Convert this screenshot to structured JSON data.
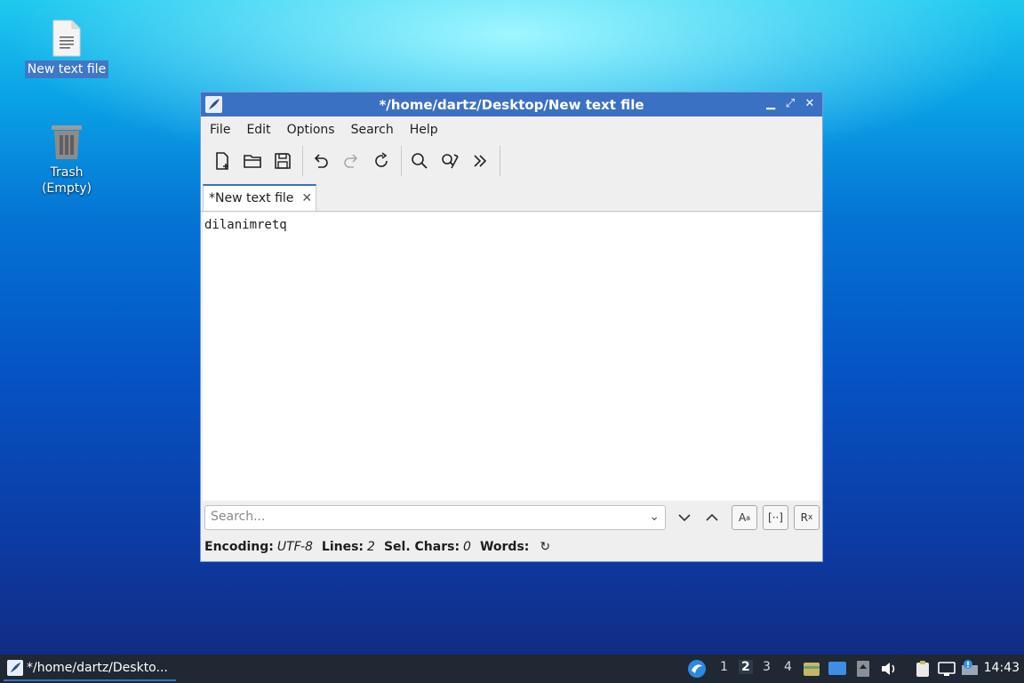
{
  "desktop": {
    "icons": [
      {
        "label": "New text file"
      },
      {
        "label": "Trash (Empty)"
      }
    ]
  },
  "window": {
    "title": "*/home/dartz/Desktop/New text file",
    "menu": [
      "File",
      "Edit",
      "Options",
      "Search",
      "Help"
    ],
    "toolbar_icons": [
      "new-file-icon",
      "open-folder-icon",
      "save-icon",
      "undo-icon",
      "redo-icon",
      "reload-icon",
      "find-icon",
      "replace-icon",
      "more-icon"
    ],
    "tab": {
      "label": "*New text file"
    },
    "editor_text": "dilanimretq",
    "search": {
      "placeholder": "Search..."
    },
    "status": {
      "encoding_label": "Encoding:",
      "encoding_value": "UTF-8",
      "lines_label": "Lines:",
      "lines_value": "2",
      "selchars_label": "Sel. Chars:",
      "selchars_value": "0",
      "words_label": "Words:"
    }
  },
  "taskbar": {
    "task_label": "*/home/dartz/Deskto...",
    "workspaces": [
      "1",
      "2",
      "3",
      "4"
    ],
    "current_workspace": "2",
    "clock": "14:43"
  },
  "colors": {
    "accent": "#3b71c2",
    "taskbar": "#1f2833"
  }
}
